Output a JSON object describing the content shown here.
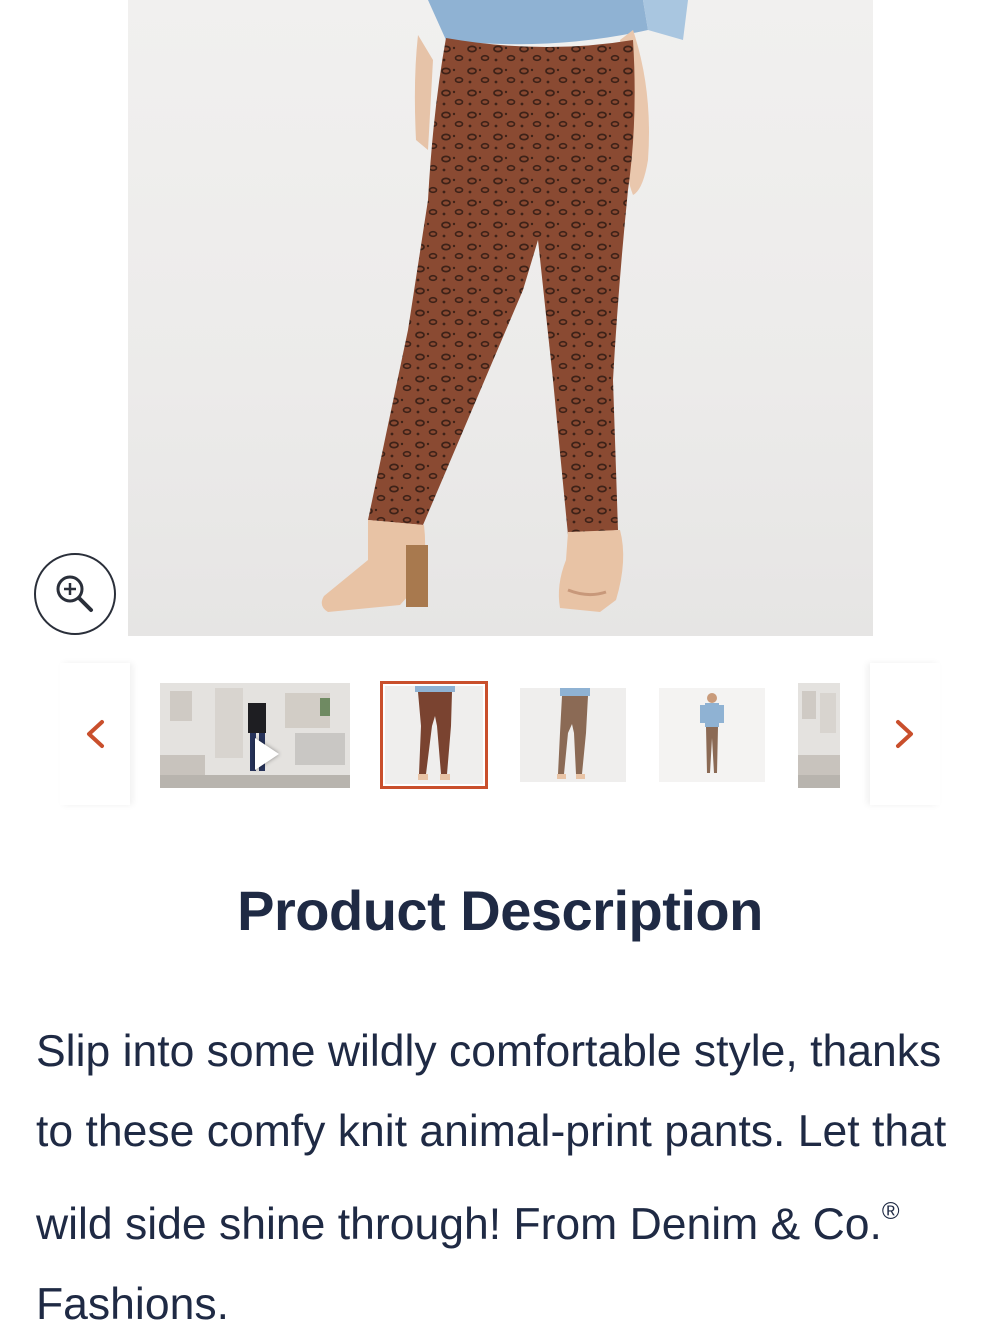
{
  "product": {
    "main_image_alt": "Woman wearing brown animal-print knit pants with nude heels",
    "zoom_icon": "zoom-in-icon"
  },
  "carousel": {
    "prev_icon": "chevron-left-icon",
    "next_icon": "chevron-right-icon",
    "accent_color": "#c94f2c",
    "thumbnails": [
      {
        "type": "video",
        "selected": false
      },
      {
        "type": "image",
        "selected": true
      },
      {
        "type": "image",
        "selected": false
      },
      {
        "type": "image",
        "selected": false
      },
      {
        "type": "video",
        "selected": false
      }
    ]
  },
  "description": {
    "title": "Product Description",
    "body": "Slip into some wildly comfortable style, thanks to these comfy knit animal-print pants. Let that wild side shine through! From Denim & Co.",
    "brand_mark": "®",
    "body_tail": " Fashions."
  },
  "colors": {
    "text": "#1f2a44",
    "accent": "#c94f2c"
  }
}
